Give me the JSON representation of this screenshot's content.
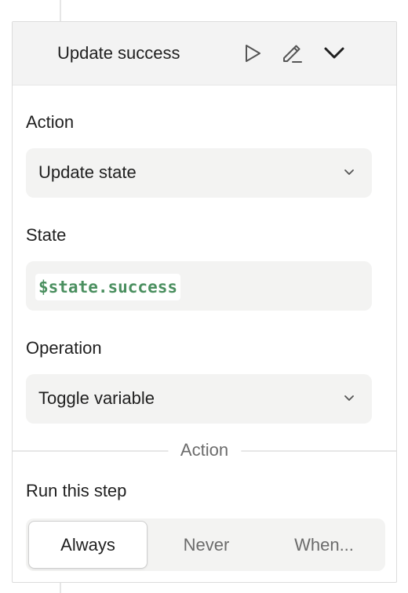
{
  "step": {
    "title": "Update success"
  },
  "header_icons": {
    "play": "play-icon",
    "edit": "pencil-icon",
    "collapse": "chevron-down-icon"
  },
  "fields": {
    "action": {
      "label": "Action",
      "value": "Update state"
    },
    "state": {
      "label": "State",
      "value": "$state.success"
    },
    "operation": {
      "label": "Operation",
      "value": "Toggle variable"
    }
  },
  "divider": {
    "label": "Action"
  },
  "run": {
    "label": "Run this step",
    "options": [
      "Always",
      "Never",
      "When..."
    ],
    "selected": "Always"
  },
  "colors": {
    "header_bg": "#f3f3f3",
    "field_bg": "#f3f3f2",
    "code_green": "#4a8f5f"
  }
}
